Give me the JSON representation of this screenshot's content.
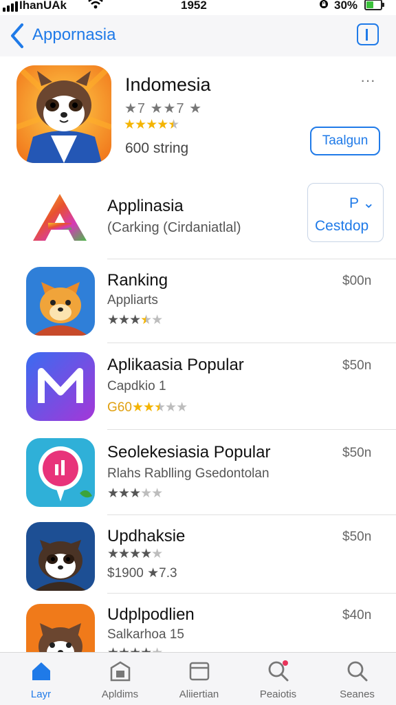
{
  "status": {
    "carrier": "IhanUAk",
    "time": "1952",
    "battery": "30%",
    "battery_level": 0.45
  },
  "nav": {
    "back_label": "Appornasia"
  },
  "featured": {
    "name": "Indomesia",
    "rating_text": "★7 ★★7 ★",
    "stars": 4.5,
    "subtitle": "600 string",
    "button": "Taalgun",
    "more_icon": "more-icon"
  },
  "first_item": {
    "name": "Applinasia",
    "subtitle": "(Carking (Cirdaniatlal)",
    "button_top": "P",
    "button_bottom": "Cestdop"
  },
  "items": [
    {
      "name": "Ranking",
      "line2": "Appliarts",
      "price": "$00n",
      "stars": 3.5
    },
    {
      "name": "Aplikaasia Popular",
      "line2": "Capdkio 1",
      "line3_prefix": "G60",
      "price": "$50n",
      "stars": 2.5
    },
    {
      "name": "Seolekesiasia Popular",
      "line2": "Rlahs Rablling Gsedontolan",
      "price": "$50n",
      "stars": 3
    },
    {
      "name": "Updhaksie",
      "line3": "$1900 ★7.3",
      "price": "$50n",
      "stars": 4
    },
    {
      "name": "Udplpodlien",
      "line2": "Salkarhoa 15",
      "price": "$40n",
      "stars": 4
    }
  ],
  "tabs": [
    {
      "label": "Layr",
      "icon": "home-icon",
      "active": true
    },
    {
      "label": "Apldims",
      "icon": "apps-icon",
      "active": false
    },
    {
      "label": "Aliiertian",
      "icon": "browser-icon",
      "active": false
    },
    {
      "label": "Peaiotis",
      "icon": "search-badge-icon",
      "active": false
    },
    {
      "label": "Seanes",
      "icon": "search-icon",
      "active": false
    }
  ],
  "colors": {
    "accent": "#1f7ae8",
    "star": "#f4b400",
    "background": "#ffffff"
  }
}
